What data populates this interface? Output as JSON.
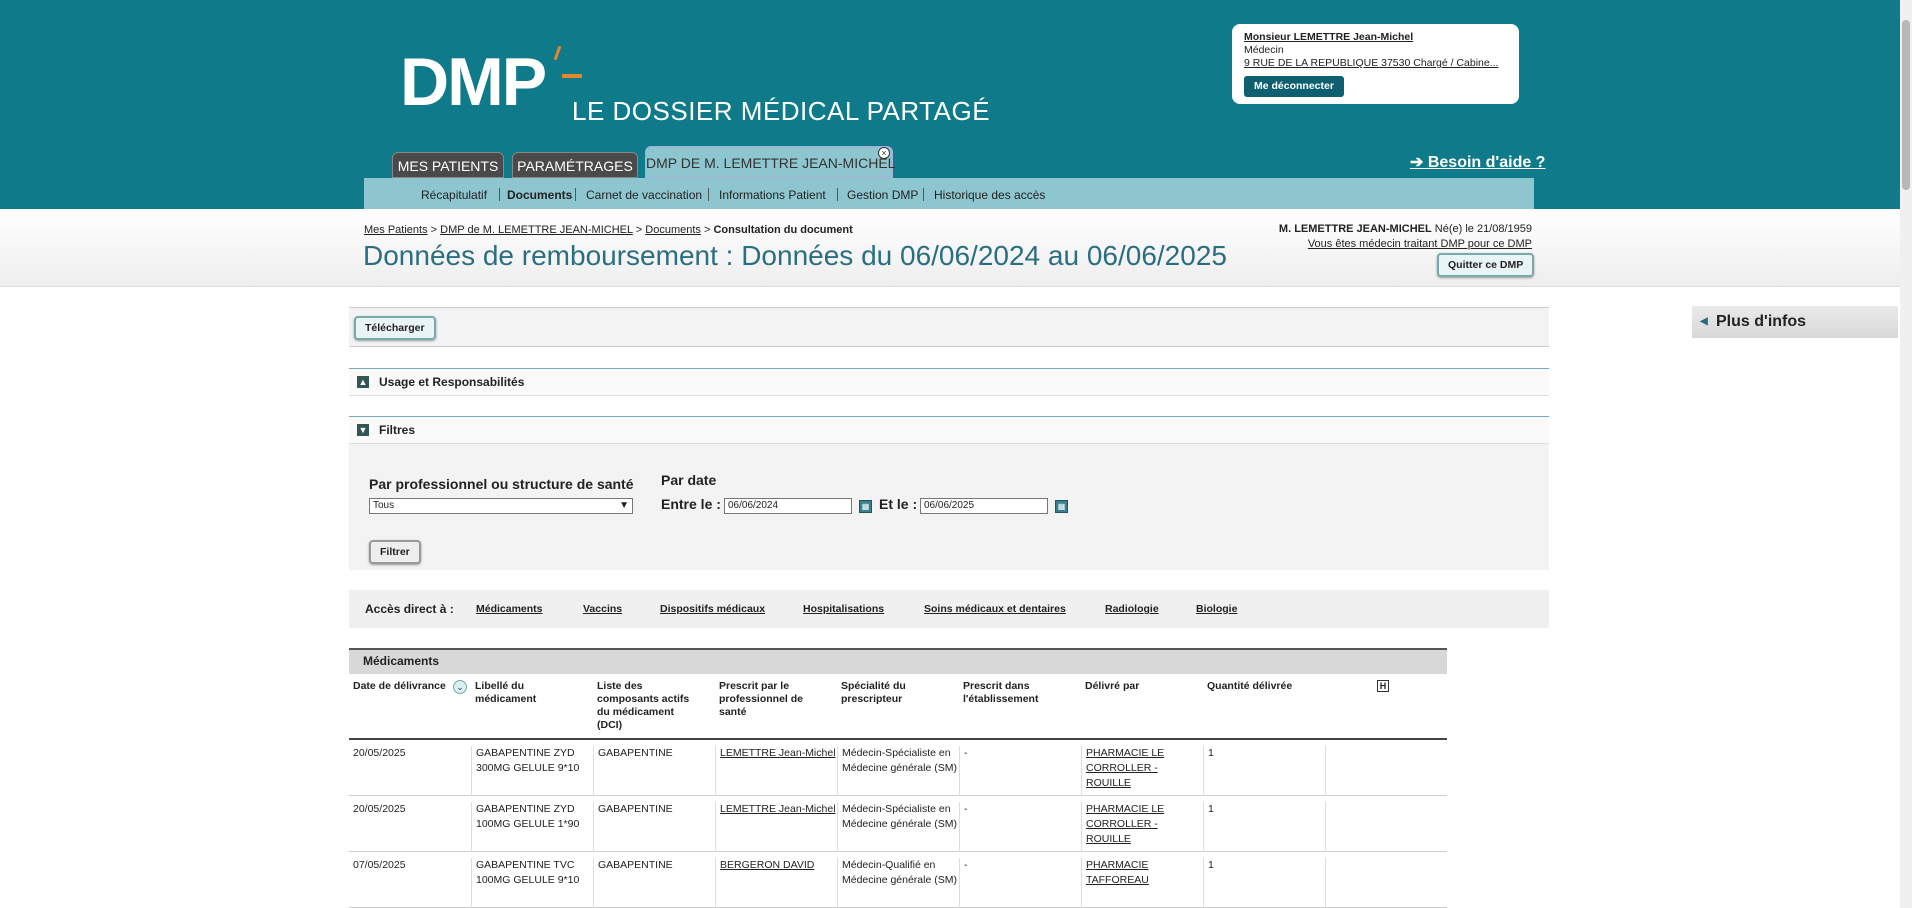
{
  "banner": {
    "logo_text": "DMP",
    "logo_tagline": "LE DOSSIER MÉDICAL PARTAGÉ",
    "help_link": "➔ Besoin d'aide ?"
  },
  "user": {
    "name": "Monsieur LEMETTRE Jean-Michel",
    "role": "Médecin",
    "address": "9 RUE DE LA REPUBLIQUE 37530 Chargé / Cabine...",
    "logout_label": "Me déconnecter"
  },
  "tabs": [
    {
      "label": "MES PATIENTS"
    },
    {
      "label": "PARAMÉTRAGES"
    },
    {
      "label": "DMP DE  M.  LEMETTRE JEAN-MICHEL"
    }
  ],
  "tab_close_glyph": "×",
  "subnav": [
    "Récapitulatif",
    "Documents",
    "Carnet de vaccination",
    "Informations Patient",
    "Gestion DMP",
    "Historique des accès"
  ],
  "breadcrumb": {
    "items": [
      "Mes Patients",
      "DMP de M. LEMETTRE JEAN-MICHEL",
      "Documents"
    ],
    "separator": ">",
    "current": "Consultation du document"
  },
  "page_title": "Données de remboursement : Données du 06/06/2024 au 06/06/2025",
  "patient": {
    "name": "M. LEMETTRE JEAN-MICHEL",
    "birth": "Né(e) le  21/08/1959",
    "treating": "Vous êtes médecin traitant DMP pour ce DMP"
  },
  "quit_label": "Quitter ce DMP",
  "download_label": "Télécharger",
  "sections": {
    "usage": "Usage et Responsabilités",
    "usage_toggle": "▲",
    "filters": "Filtres",
    "filters_toggle": "▼"
  },
  "filters": {
    "professional_label": "Par professionnel ou structure de santé",
    "professional_value": "Tous",
    "select_chevron": "▼",
    "date_label": "Par date",
    "between_label": "Entre le :",
    "between_value": "06/06/2024",
    "and_label": "Et le :",
    "and_value": "06/06/2025",
    "calendar_glyph": "▦",
    "filter_button": "Filtrer"
  },
  "direct_access": {
    "label": "Accès direct à :",
    "links": [
      "Médicaments",
      "Vaccins",
      "Dispositifs médicaux",
      "Hospitalisations",
      "Soins médicaux et dentaires",
      "Radiologie",
      "Biologie"
    ]
  },
  "medications": {
    "section_title": "Médicaments",
    "sort_glyph": "⌄",
    "history_glyph": "H",
    "columns": [
      "Date de délivrance",
      "Libellé du médicament",
      "Liste des composants actifs du médicament (DCI)",
      "Prescrit par le professionnel de santé",
      "Spécialité du prescripteur",
      "Prescrit dans l'établissement",
      "Délivré par",
      "Quantité délivrée"
    ],
    "rows": [
      {
        "date": "20/05/2025",
        "label": "GABAPENTINE ZYD 300MG GELULE 9*10",
        "dci": "GABAPENTINE",
        "prescriber": "LEMETTRE Jean-Michel",
        "specialty": "Médecin-Spécialiste en Médecine générale (SM)",
        "establishment": "-",
        "delivered_by": "PHARMACIE LE CORROLLER - ROUILLE",
        "quantity": "1"
      },
      {
        "date": "20/05/2025",
        "label": "GABAPENTINE ZYD 100MG GELULE 1*90",
        "dci": "GABAPENTINE",
        "prescriber": "LEMETTRE Jean-Michel",
        "specialty": "Médecin-Spécialiste en Médecine générale (SM)",
        "establishment": "-",
        "delivered_by": "PHARMACIE LE CORROLLER - ROUILLE",
        "quantity": "1"
      },
      {
        "date": "07/05/2025",
        "label": "GABAPENTINE TVC 100MG GELULE 9*10",
        "dci": "GABAPENTINE",
        "prescriber": "BERGERON DAVID",
        "specialty": "Médecin-Qualifié en Médecine générale (SM)",
        "establishment": "-",
        "delivered_by": "PHARMACIE TAFFOREAU",
        "quantity": "1"
      }
    ]
  },
  "side_panel": {
    "title": "Plus d'infos",
    "toggle": "◀"
  },
  "colors": {
    "brand": "#0e7a8a",
    "subnav": "#8ec6cf",
    "title": "#2a6f80",
    "logo_accent": "#e2872c"
  }
}
